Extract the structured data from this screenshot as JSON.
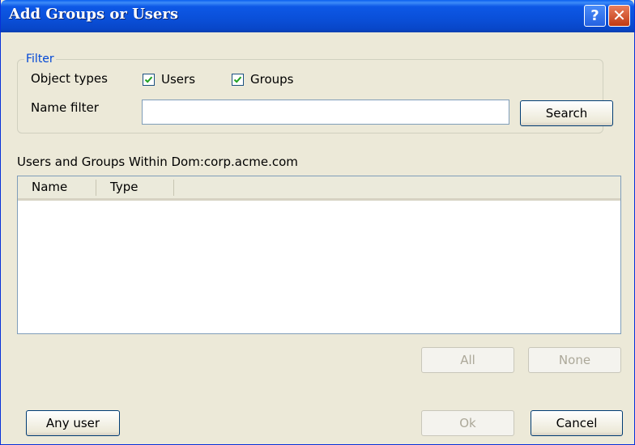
{
  "window": {
    "title": "Add Groups or Users"
  },
  "filter": {
    "legend": "Filter",
    "object_types_label": "Object types",
    "users_label": "Users",
    "groups_label": "Groups",
    "users_checked": true,
    "groups_checked": true,
    "name_filter_label": "Name filter",
    "name_filter_value": "",
    "search_label": "Search"
  },
  "results": {
    "heading": "Users and Groups Within Dom:corp.acme.com",
    "columns": [
      "Name",
      "Type"
    ],
    "rows": []
  },
  "buttons": {
    "all": "All",
    "none": "None",
    "any_user": "Any user",
    "ok": "Ok",
    "cancel": "Cancel"
  }
}
